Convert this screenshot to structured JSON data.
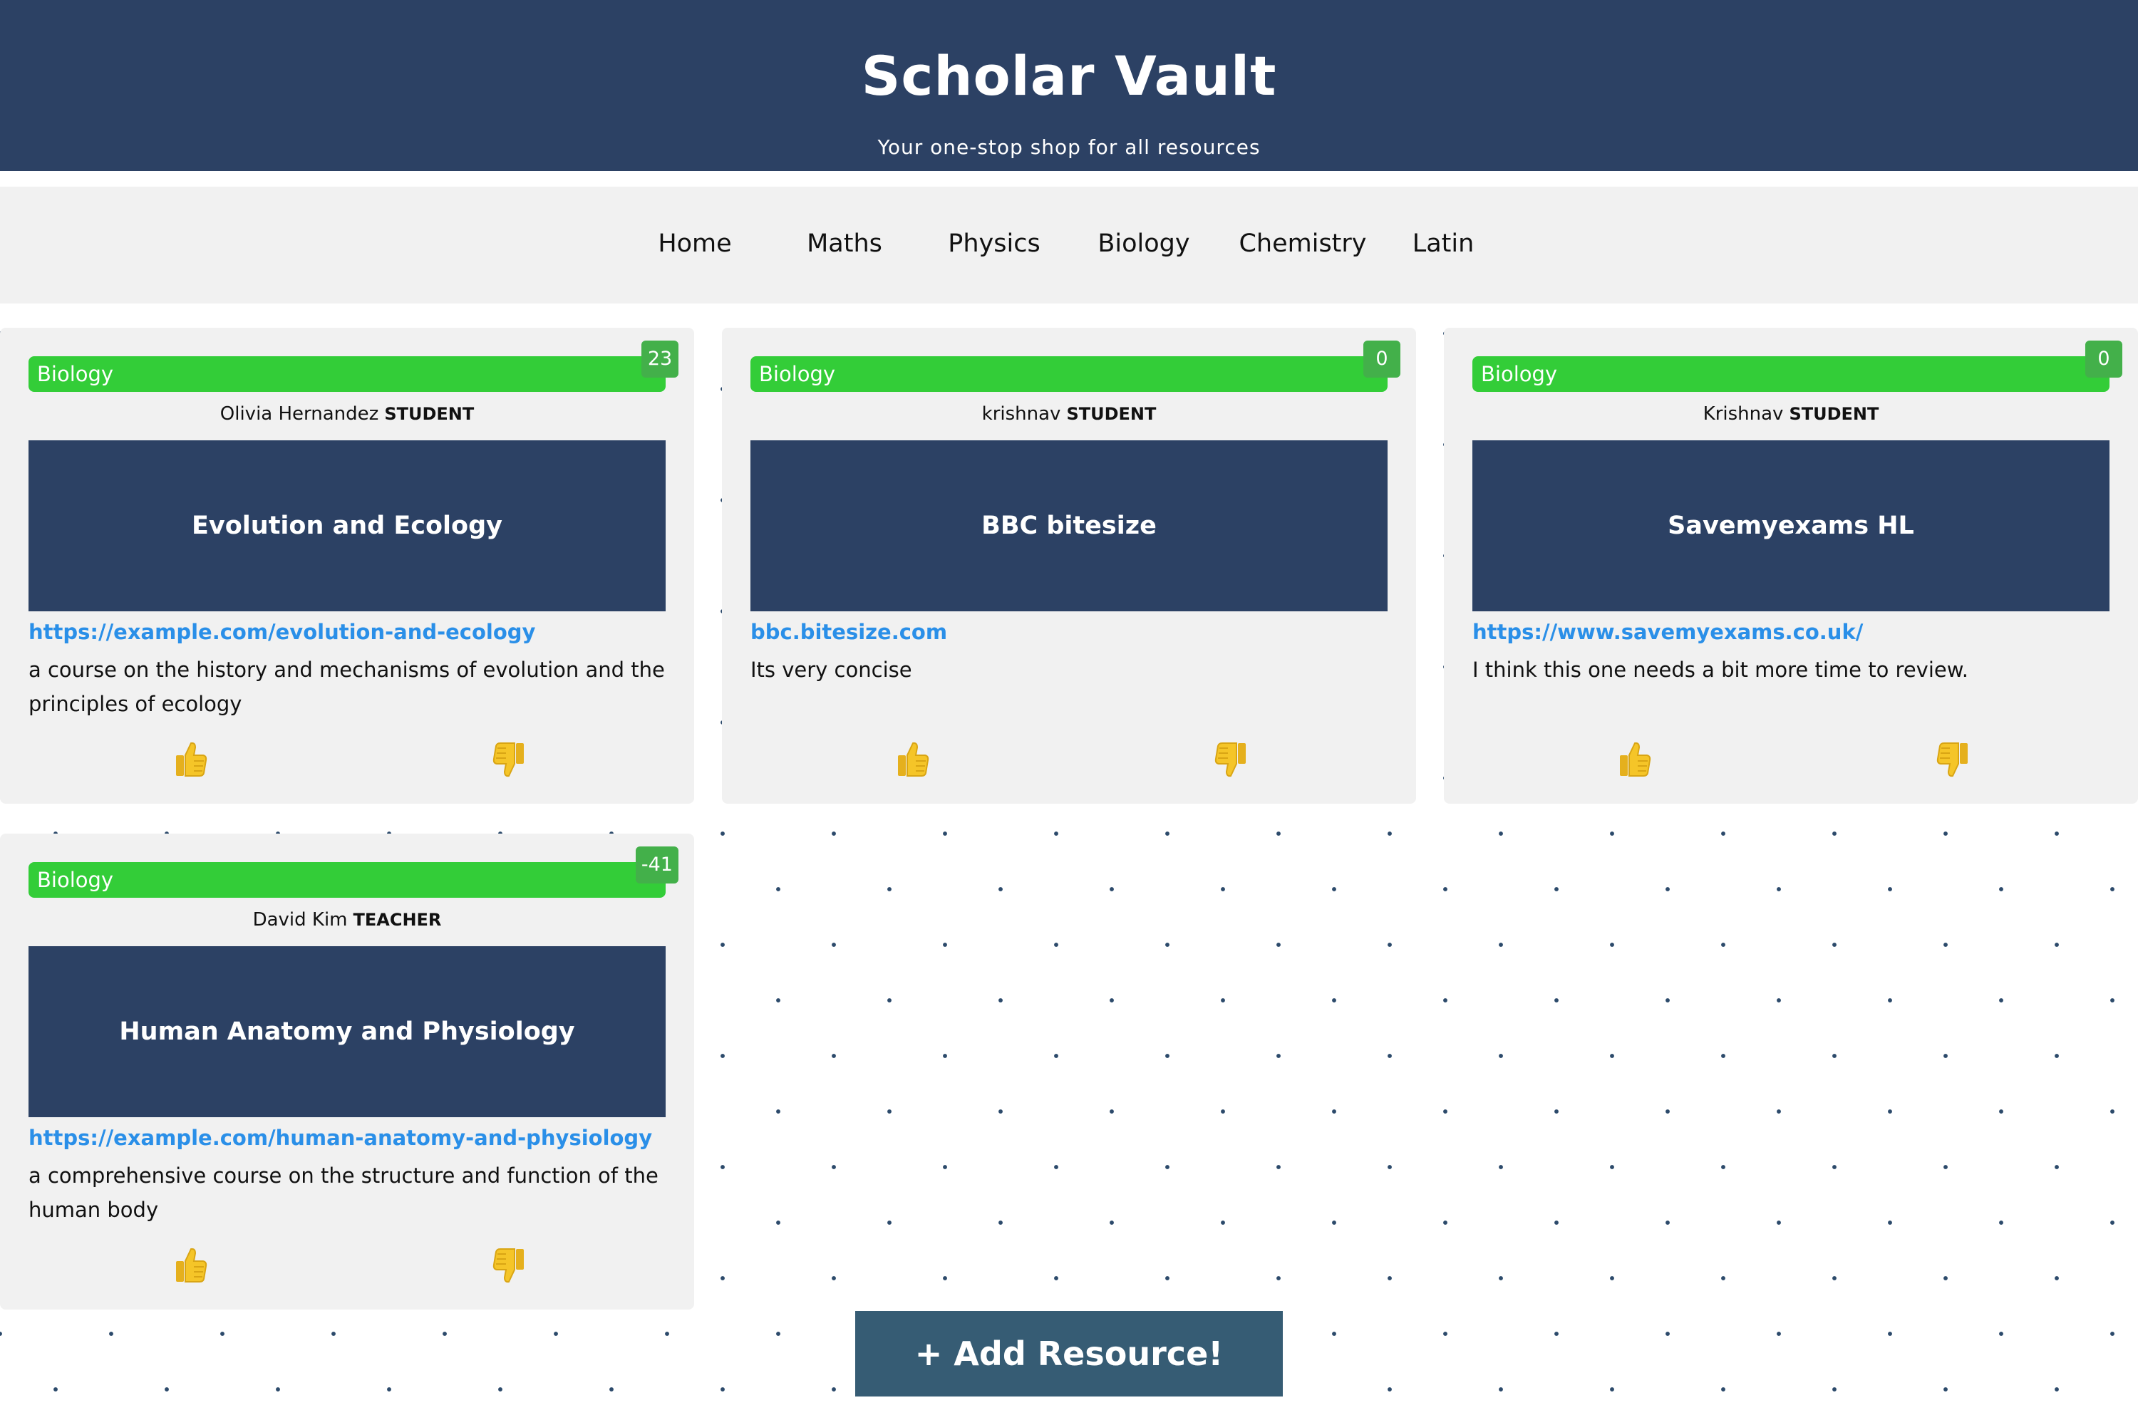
{
  "header": {
    "title": "Scholar Vault",
    "subtitle": "Your one-stop shop for all resources"
  },
  "nav": {
    "items": [
      "Home",
      "Maths",
      "Physics",
      "Biology",
      "Chemistry",
      "Latin"
    ]
  },
  "cards": [
    {
      "category": "Biology",
      "score": "23",
      "author": "Olivia Hernandez",
      "role": "STUDENT",
      "title": "Evolution and Ecology",
      "link": "https://example.com/evolution-and-ecology",
      "description": "a course on the history and mechanisms of evolution and the principles of ecology",
      "thumbs_up_icon": "thumbs-up-icon",
      "thumbs_down_icon": "thumbs-down-icon"
    },
    {
      "category": "Biology",
      "score": "0",
      "author": "krishnav",
      "role": "STUDENT",
      "title": "BBC bitesize",
      "link": "bbc.bitesize.com",
      "description": "Its very concise",
      "thumbs_up_icon": "thumbs-up-icon",
      "thumbs_down_icon": "thumbs-down-icon"
    },
    {
      "category": "Biology",
      "score": "0",
      "author": "Krishnav",
      "role": "STUDENT",
      "title": "Savemyexams HL",
      "link": "https://www.savemyexams.co.uk/",
      "description": "I think this one needs a bit more time to review.",
      "thumbs_up_icon": "thumbs-up-icon",
      "thumbs_down_icon": "thumbs-down-icon"
    },
    {
      "category": "Biology",
      "score": "-41",
      "author": "David Kim",
      "role": "TEACHER",
      "title": "Human Anatomy and Physiology",
      "link": "https://example.com/human-anatomy-and-physiology",
      "description": "a comprehensive course on the structure and function of the human body",
      "thumbs_up_icon": "thumbs-up-icon",
      "thumbs_down_icon": "thumbs-down-icon"
    }
  ],
  "add_button": {
    "label": "+ Add Resource!"
  },
  "colors": {
    "header_bg": "#2c4164",
    "category_green": "#33cd38",
    "badge_green": "#43b04a",
    "link_blue": "#2a8fe8",
    "thumb_yellow": "#f5c528",
    "button_bg": "#365c74"
  }
}
